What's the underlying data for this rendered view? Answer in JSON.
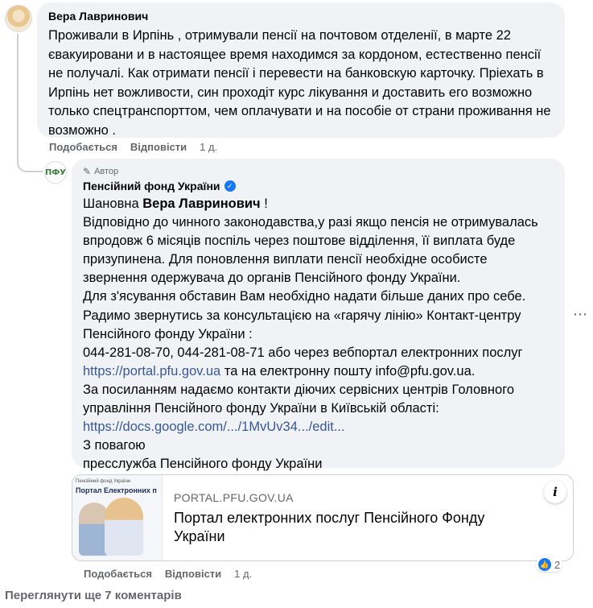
{
  "comment1": {
    "author": "Вера Лавринович",
    "text": "Проживали в Ирпінь , отримували пенсії на почтовом отделенії, в марте 22 євакуировани и в настоящее время находимся за кордоном, естественно пенсії не получалі. Как отримати пенсії і перевести на банковскую карточку. Пріехать в Ирпінь нет вожливости, син проходіт курс лікування и доставить его возможно только спецтранспорттом, чем оплачувати и на пособіе от страни проживання не возможно .",
    "like_label": "Подобається",
    "reply_label": "Відповісти",
    "time": "1 д."
  },
  "reply": {
    "badge": "Автор",
    "author": "Пенсійний фонд України",
    "avatar_label": "ПФУ",
    "greeting_prefix": "Шановна",
    "greeting_name": "Вера Лавринович",
    "greeting_suffix": " !",
    "para1": "Відповідно до чинного законодавства,у разі якщо пенсія не отримувалась впродовж 6 місяців поспіль через поштове відділення, її виплата буде призупинена. Для поновлення виплати пенсії необхідне особисте звернення одержувача до органів Пенсійного фонду України.",
    "para2": "Для з'ясування обставин Вам необхідно надати більше даних про себе.",
    "para3": "Радимо звернутись за консультацією на «гарячу лінію» Контакт-центру Пенсійного фонду України :",
    "para4": "044-281-08-70, 044-281-08-71 або через вебпортал електронних послуг",
    "link1": "https://portal.pfu.gov.ua",
    "para4b": " та на електронну пошту info@pfu.gov.ua.",
    "para5": "За посиланням надаємо контакти діючих сервісних центрів Головного управління Пенсійного фонду України в Київській області:",
    "link2": "https://docs.google.com/.../1MvUv34.../edit...",
    "closing1": "З повагою",
    "closing2": "пресслужба Пенсійного фонду України",
    "like_label": "Подобається",
    "reply_label": "Відповісти",
    "time": "1 д.",
    "reaction_count": "2"
  },
  "preview": {
    "image_small_title": "Пенсійний фонд України",
    "image_title": "Портал Електронних п",
    "domain": "PORTAL.PFU.GOV.UA",
    "title": "Портал електронних послуг Пенсійного Фонду України"
  },
  "view_more": "Переглянути ще 7 коментарів",
  "colors": {
    "bubble": "#f0f2f5",
    "link": "#385898",
    "secondary_text": "#65676b",
    "brand_blue": "#1877f2"
  }
}
